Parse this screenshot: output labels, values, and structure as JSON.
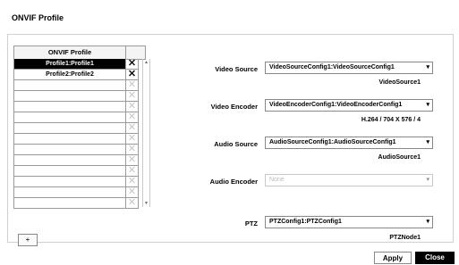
{
  "window": {
    "title": "ONVIF Profile"
  },
  "profiles": {
    "header": "ONVIF Profile",
    "rows": [
      {
        "name": "Profile1:Profile1",
        "delete": "✕",
        "active": true,
        "selected": true
      },
      {
        "name": "Profile2:Profile2",
        "delete": "✕",
        "active": true,
        "selected": false
      },
      {
        "name": "",
        "delete": "✕",
        "active": false,
        "selected": false
      },
      {
        "name": "",
        "delete": "✕",
        "active": false,
        "selected": false
      },
      {
        "name": "",
        "delete": "✕",
        "active": false,
        "selected": false
      },
      {
        "name": "",
        "delete": "✕",
        "active": false,
        "selected": false
      },
      {
        "name": "",
        "delete": "✕",
        "active": false,
        "selected": false
      },
      {
        "name": "",
        "delete": "✕",
        "active": false,
        "selected": false
      },
      {
        "name": "",
        "delete": "✕",
        "active": false,
        "selected": false
      },
      {
        "name": "",
        "delete": "✕",
        "active": false,
        "selected": false
      },
      {
        "name": "",
        "delete": "✕",
        "active": false,
        "selected": false
      },
      {
        "name": "",
        "delete": "✕",
        "active": false,
        "selected": false
      },
      {
        "name": "",
        "delete": "✕",
        "active": false,
        "selected": false
      },
      {
        "name": "",
        "delete": "✕",
        "active": false,
        "selected": false
      }
    ],
    "add_label": "+"
  },
  "form": {
    "video_source": {
      "label": "Video Source",
      "value": "VideoSourceConfig1:VideoSourceConfig1",
      "sub": "VideoSource1"
    },
    "video_encoder": {
      "label": "Video Encoder",
      "value": "VideoEncoderConfig1:VideoEncoderConfig1",
      "sub": "H.264 / 704 X 576 / 4"
    },
    "audio_source": {
      "label": "Audio Source",
      "value": "AudioSourceConfig1:AudioSourceConfig1",
      "sub": "AudioSource1"
    },
    "audio_encoder": {
      "label": "Audio Encoder",
      "value": "None"
    },
    "ptz": {
      "label": "PTZ",
      "value": "PTZConfig1:PTZConfig1",
      "sub": "PTZNode1"
    }
  },
  "buttons": {
    "apply": "Apply",
    "close": "Close"
  }
}
